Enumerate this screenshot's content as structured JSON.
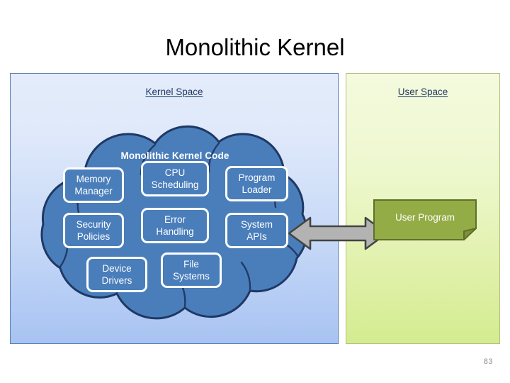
{
  "slide": {
    "title": "Monolithic Kernel",
    "page_number": "83"
  },
  "kernel_space": {
    "label": "Kernel Space",
    "cloud_heading": "Monolithic Kernel Code",
    "components": [
      {
        "label": "Memory\nManager",
        "name": "memory-manager"
      },
      {
        "label": "CPU\nScheduling",
        "name": "cpu-scheduling"
      },
      {
        "label": "Program\nLoader",
        "name": "program-loader"
      },
      {
        "label": "Security\nPolicies",
        "name": "security-policies"
      },
      {
        "label": "Error\nHandling",
        "name": "error-handling"
      },
      {
        "label": "System\nAPIs",
        "name": "system-apis"
      },
      {
        "label": "Device\nDrivers",
        "name": "device-drivers"
      },
      {
        "label": "File\nSystems",
        "name": "file-systems"
      }
    ]
  },
  "user_space": {
    "label": "User Space",
    "program_label": "User Program"
  },
  "connector": {
    "name": "double-headed-arrow",
    "direction": "bidirectional"
  },
  "colors": {
    "cloud_fill": "#4a7ebb",
    "cloud_stroke": "#1f3864",
    "box_fill": "#4a7ebb",
    "box_border": "#ffffff",
    "kernel_panel_top": "#e4ecfb",
    "kernel_panel_bottom": "#a8c3f2",
    "kernel_panel_border": "#5b81b0",
    "user_panel_top": "#f4fade",
    "user_panel_bottom": "#d4ec90",
    "user_panel_border": "#b7bf7e",
    "user_program_fill": "#94ac46",
    "user_program_border": "#5f6f2b",
    "arrow_fill": "#b3b3b3",
    "arrow_stroke": "#444444",
    "label_text": "#1f3864",
    "title_text": "#000000",
    "page_number_text": "#8f8f8f"
  }
}
